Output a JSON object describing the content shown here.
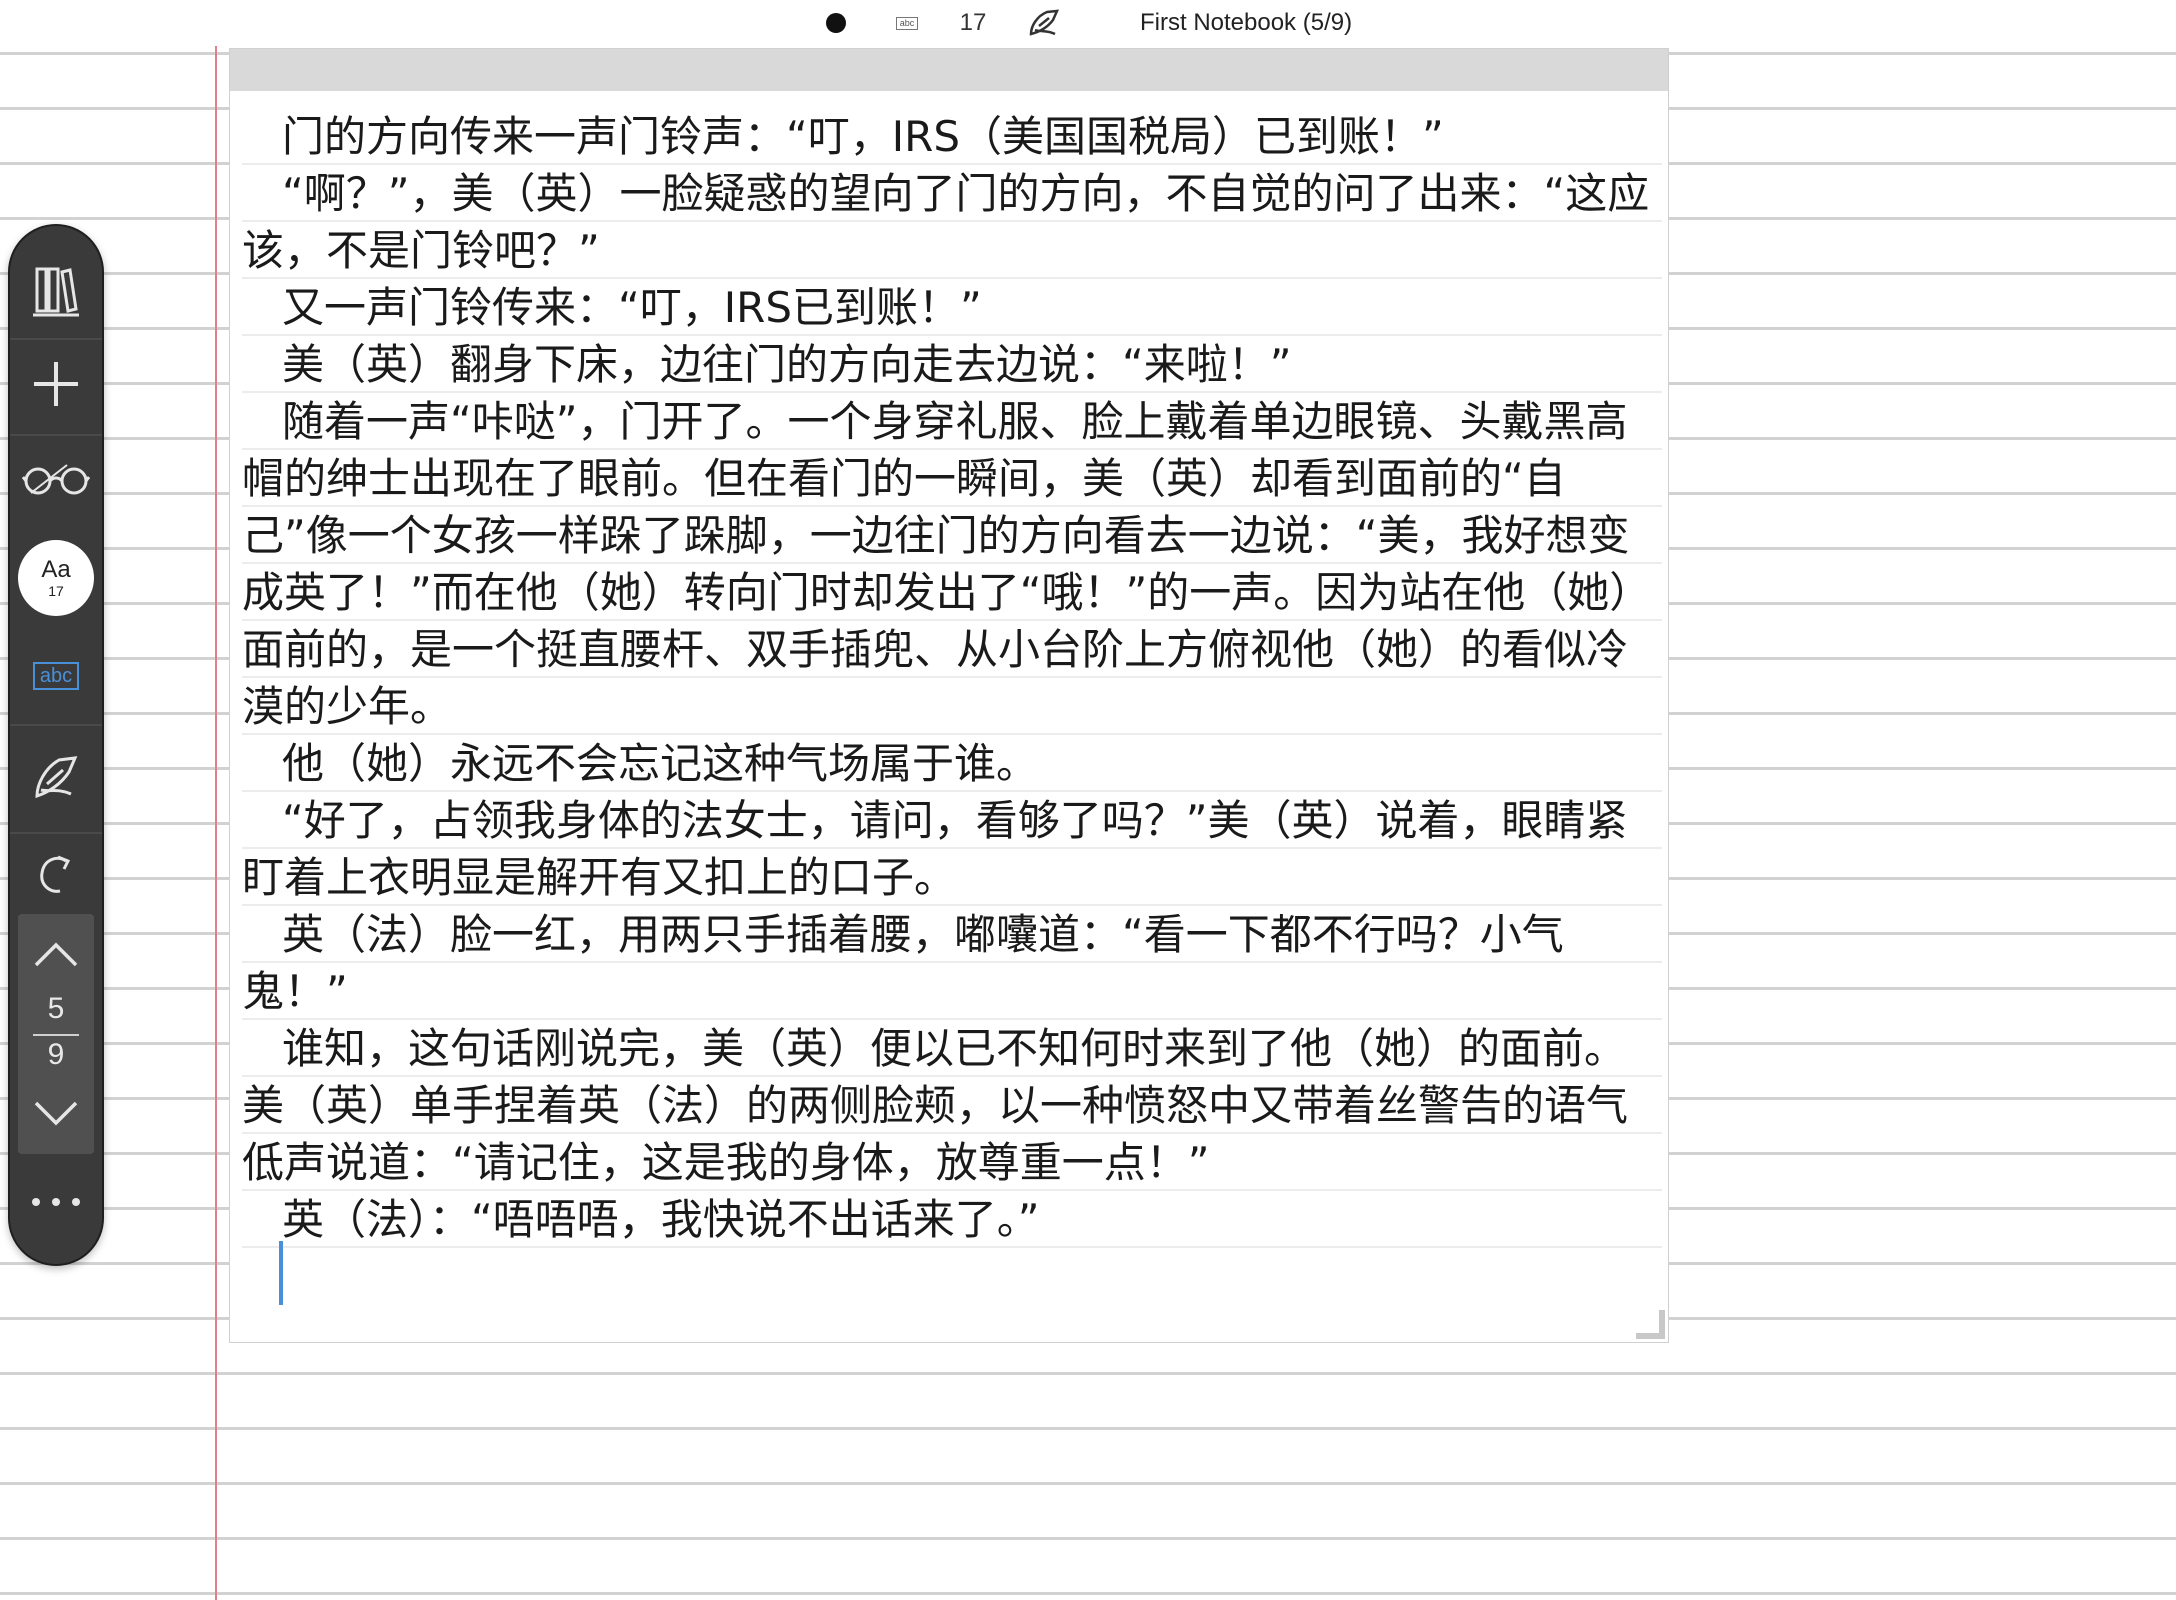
{
  "topbar": {
    "color_icon": "black-dot-icon",
    "text_tool_label": "abc",
    "font_size": "17",
    "pen_icon": "pen-icon",
    "title": "First Notebook (5/9)"
  },
  "toolbar": {
    "tools": [
      "library-icon",
      "add-icon",
      "glasses-icon",
      "font-icon",
      "text-abc-icon",
      "pen-icon",
      "redo-icon",
      "chevron-up-icon",
      "chevron-down-icon",
      "more-icon"
    ],
    "font_label": "Aa",
    "font_size": "17",
    "abc_label": "abc",
    "current_page": "5",
    "total_pages": "9",
    "accent_color": "#4a90d9"
  },
  "note": {
    "paragraphs": [
      "门的方向传来一声门铃声：“叮，IRS（美国国税局）已到账！”",
      "“啊？”，美（英）一脸疑惑的望向了门的方向，不自觉的问了出来：“这应该，不是门铃吧？”",
      "又一声门铃传来：“叮，IRS已到账！”",
      "美（英）翻身下床，边往门的方向走去边说：“来啦！”",
      "随着一声“咔哒”，门开了。一个身穿礼服、脸上戴着单边眼镜、头戴黑高帽的绅士出现在了眼前。但在看门的一瞬间，美（英）却看到面前的“自己”像一个女孩一样跺了跺脚，一边往门的方向看去一边说：“美，我好想变成英了！”而在他（她）转向门时却发出了“哦！”的一声。因为站在他（她）面前的，是一个挺直腰杆、双手插兜、从小台阶上方俯视他（她）的看似冷漠的少年。",
      "他（她）永远不会忘记这种气场属于谁。",
      "“好了，占领我身体的法女士，请问，看够了吗？”美（英）说着，眼睛紧盯着上衣明显是解开有又扣上的口子。",
      "英（法）脸一红，用两只手插着腰，嘟囔道：“看一下都不行吗？小气鬼！”",
      "谁知，这句话刚说完，美（英）便以已不知何时来到了他（她）的面前。美（英）单手捏着英（法）的两侧脸颊，以一种愤怒中又带着丝警告的语气低声说道：“请记住，这是我的身体，放尊重一点！”",
      "英（法）：“唔唔唔，我快说不出话来了。”"
    ]
  }
}
